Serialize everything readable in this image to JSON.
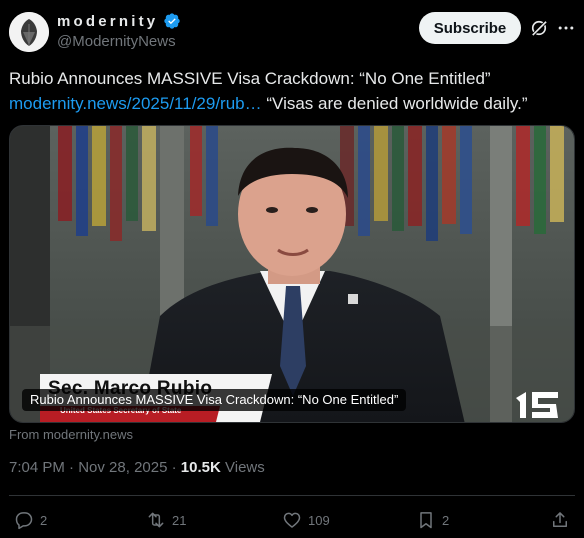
{
  "account": {
    "display_name": "modernity",
    "handle": "@ModernityNews",
    "verified": true
  },
  "header": {
    "subscribe_label": "Subscribe"
  },
  "tweet": {
    "text": "Rubio Announces MASSIVE Visa Crackdown: “No One Entitled”",
    "link_text": "modernity.news/2025/11/29/rub…",
    "quote": "“Visas are denied worldwide daily.”"
  },
  "media": {
    "caption": "Rubio Announces MASSIVE Visa Crackdown: “No One Entitled”",
    "lower_third_name": "Sec. Marco Rubio",
    "lower_third_title": "United States Secretary of State",
    "source": "From modernity.news"
  },
  "meta": {
    "time": "7:04 PM",
    "date": "Nov 28, 2025",
    "views_count": "10.5K",
    "views_label": "Views"
  },
  "actions": {
    "replies": "2",
    "reposts": "21",
    "likes": "109",
    "bookmarks": "2"
  },
  "colors": {
    "background": "#000000",
    "text": "#e7e9ea",
    "muted": "#71767b",
    "link": "#1d9bf0",
    "verified": "#1d9bf0",
    "divider": "#2f3336"
  }
}
